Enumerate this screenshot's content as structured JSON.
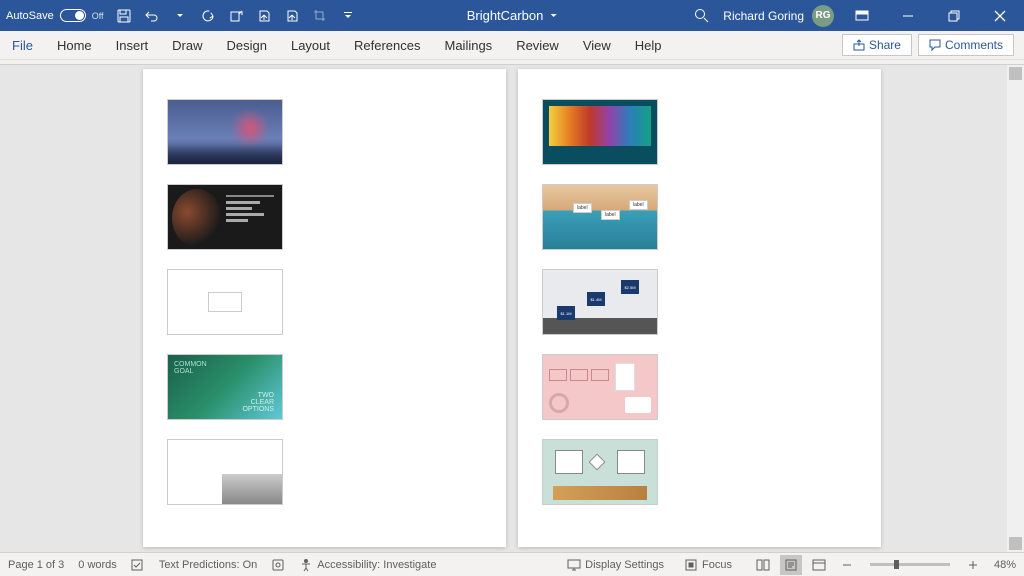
{
  "titlebar": {
    "autosave_label": "AutoSave",
    "autosave_state": "Off",
    "doc_title": "BrightCarbon",
    "user_name": "Richard Goring",
    "user_initials": "RG"
  },
  "ribbon": {
    "tabs": [
      "File",
      "Home",
      "Insert",
      "Draw",
      "Design",
      "Layout",
      "References",
      "Mailings",
      "Review",
      "View",
      "Help"
    ],
    "share": "Share",
    "comments": "Comments"
  },
  "thumbs_left": {
    "t4_line1": "COMMON",
    "t4_line2": "GOAL",
    "t4_line3": "TWO",
    "t4_line4": "CLEAR",
    "t4_line5": "OPTIONS"
  },
  "thumbs_right": {
    "t8_a": "$1.1M",
    "t8_b": "$1.4M",
    "t8_c": "$2.5M"
  },
  "statusbar": {
    "page": "Page 1 of 3",
    "words": "0 words",
    "predictions": "Text Predictions: On",
    "accessibility": "Accessibility: Investigate",
    "display_settings": "Display Settings",
    "focus": "Focus",
    "zoom": "48%"
  }
}
